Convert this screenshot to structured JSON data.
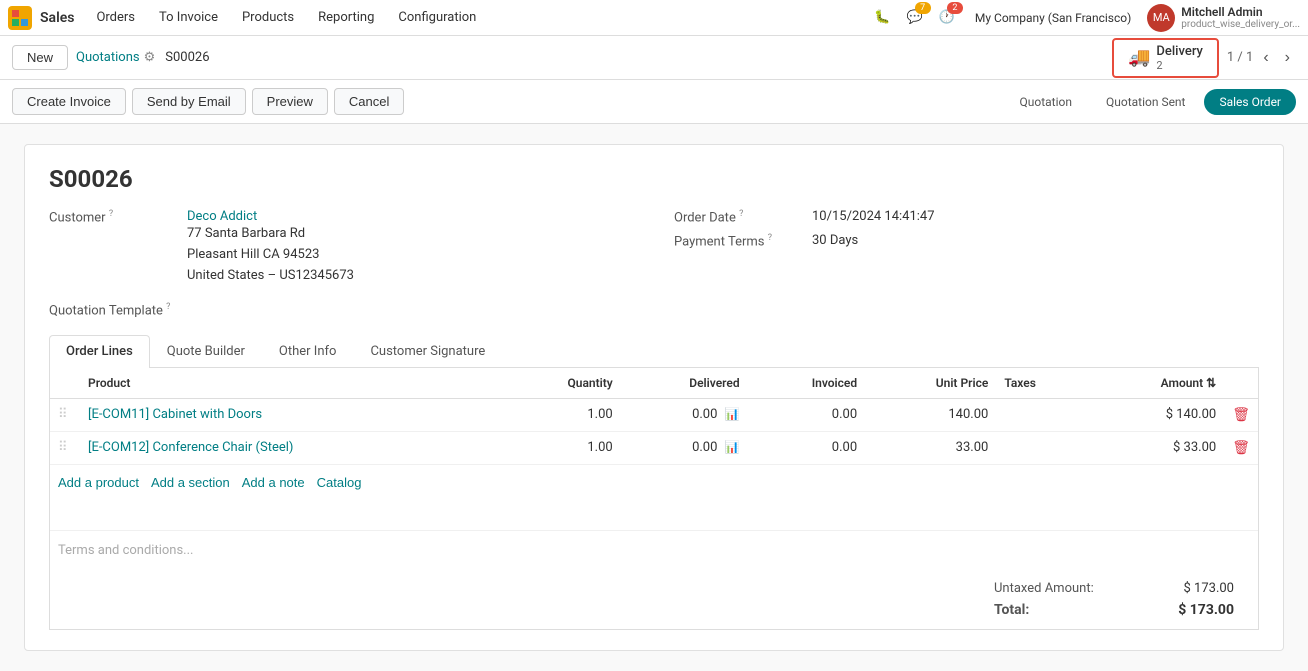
{
  "nav": {
    "logo_color": "#f0a500",
    "app_name": "Sales",
    "items": [
      "Orders",
      "To Invoice",
      "Products",
      "Reporting",
      "Configuration"
    ],
    "company": "My Company (San Francisco)",
    "user_name": "Mitchell Admin",
    "user_sub": "product_wise_delivery_or...",
    "notifications": {
      "bug": "",
      "chat": "7",
      "activity": "2"
    }
  },
  "action_bar": {
    "new_label": "New",
    "breadcrumb": "Quotations",
    "record_id": "S00026",
    "delivery_label": "Delivery",
    "delivery_count": "2",
    "pager": "1 / 1"
  },
  "toolbar": {
    "buttons": [
      "Create Invoice",
      "Send by Email",
      "Preview",
      "Cancel"
    ],
    "statuses": [
      "Quotation",
      "Quotation Sent",
      "Sales Order"
    ],
    "active_status": "Sales Order"
  },
  "order": {
    "title": "S00026",
    "customer_label": "Customer",
    "customer_name": "Deco Addict",
    "customer_address": [
      "77 Santa Barbara Rd",
      "Pleasant Hill CA 94523",
      "United States – US12345673"
    ],
    "order_date_label": "Order Date",
    "order_date": "10/15/2024 14:41:47",
    "payment_terms_label": "Payment Terms",
    "payment_terms": "30 Days",
    "quotation_template_label": "Quotation Template"
  },
  "tabs": [
    "Order Lines",
    "Quote Builder",
    "Other Info",
    "Customer Signature"
  ],
  "active_tab": "Order Lines",
  "table": {
    "columns": [
      "Product",
      "Quantity",
      "Delivered",
      "Invoiced",
      "Unit Price",
      "Taxes",
      "Amount"
    ],
    "rows": [
      {
        "product": "[E-COM11] Cabinet with Doors",
        "quantity": "1.00",
        "delivered": "0.00",
        "invoiced": "0.00",
        "unit_price": "140.00",
        "taxes": "",
        "amount": "$ 140.00"
      },
      {
        "product": "[E-COM12] Conference Chair (Steel)",
        "quantity": "1.00",
        "delivered": "0.00",
        "invoiced": "0.00",
        "unit_price": "33.00",
        "taxes": "",
        "amount": "$ 33.00"
      }
    ],
    "actions": [
      "Add a product",
      "Add a section",
      "Add a note",
      "Catalog"
    ]
  },
  "totals": {
    "untaxed_label": "Untaxed Amount:",
    "untaxed_value": "$ 173.00",
    "total_label": "Total:",
    "total_value": "$ 173.00"
  },
  "terms_placeholder": "Terms and conditions..."
}
